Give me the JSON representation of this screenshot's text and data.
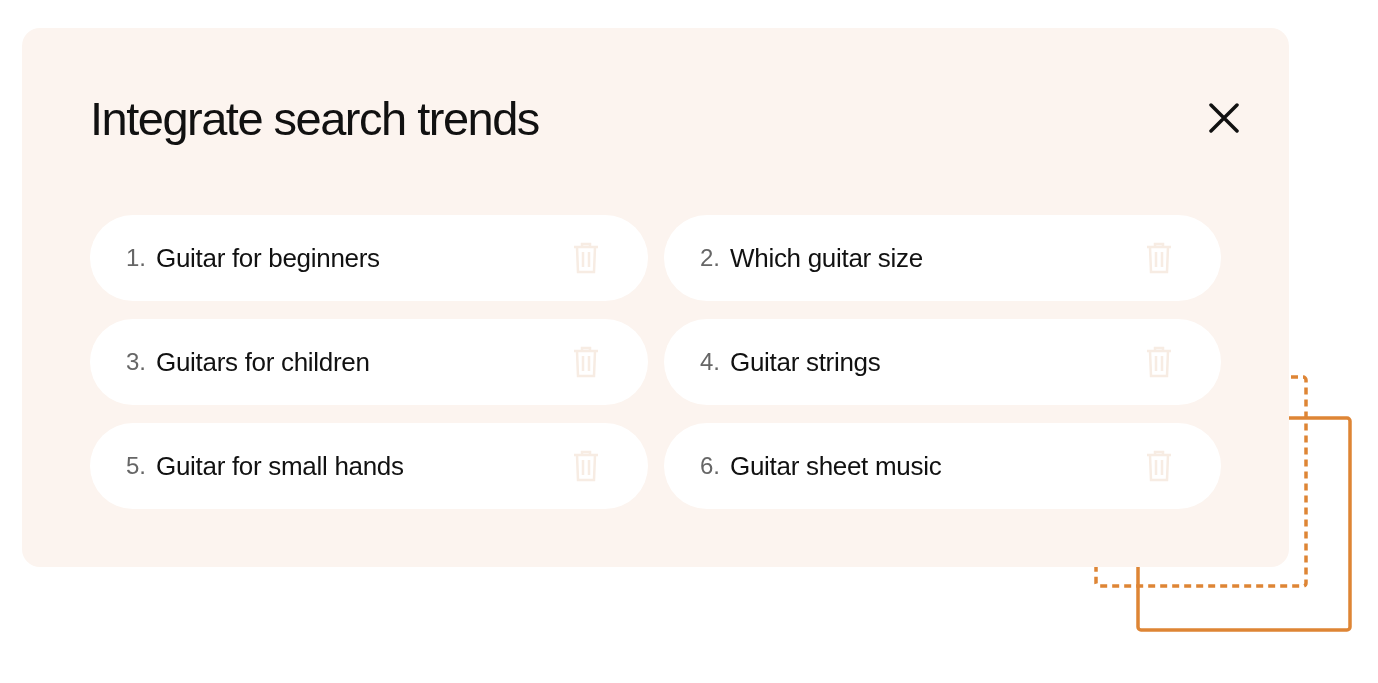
{
  "dialog": {
    "title": "Integrate search trends",
    "trends": [
      {
        "number": "1.",
        "label": "Guitar for beginners"
      },
      {
        "number": "2.",
        "label": "Which guitar size"
      },
      {
        "number": "3.",
        "label": "Guitars for children"
      },
      {
        "number": "4.",
        "label": "Guitar strings"
      },
      {
        "number": "5.",
        "label": "Guitar for small hands"
      },
      {
        "number": "6.",
        "label": "Guitar sheet music"
      }
    ]
  }
}
